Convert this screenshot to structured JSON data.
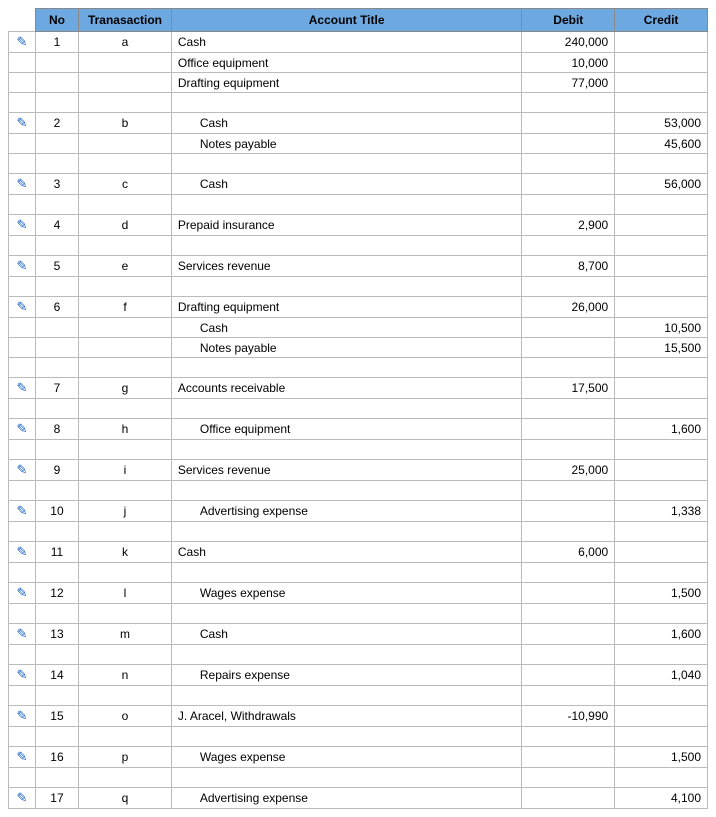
{
  "headers": {
    "no": "No",
    "transaction": "Tranasaction",
    "account_title": "Account Title",
    "debit": "Debit",
    "credit": "Credit"
  },
  "pencil_glyph": "✎",
  "rows": [
    {
      "edit": true,
      "no": "1",
      "trans": "a",
      "title": "Cash",
      "indent": 0,
      "debit": "240,000",
      "credit": ""
    },
    {
      "edit": false,
      "no": "",
      "trans": "",
      "title": "Office equipment",
      "indent": 0,
      "debit": "10,000",
      "credit": ""
    },
    {
      "edit": false,
      "no": "",
      "trans": "",
      "title": "Drafting equipment",
      "indent": 0,
      "debit": "77,000",
      "credit": ""
    },
    {
      "edit": false,
      "no": "",
      "trans": "",
      "title": "",
      "indent": 0,
      "debit": "",
      "credit": ""
    },
    {
      "edit": true,
      "no": "2",
      "trans": "b",
      "title": "Cash",
      "indent": 1,
      "debit": "",
      "credit": "53,000"
    },
    {
      "edit": false,
      "no": "",
      "trans": "",
      "title": "Notes payable",
      "indent": 1,
      "debit": "",
      "credit": "45,600"
    },
    {
      "edit": false,
      "no": "",
      "trans": "",
      "title": "",
      "indent": 0,
      "debit": "",
      "credit": ""
    },
    {
      "edit": true,
      "no": "3",
      "trans": "c",
      "title": "Cash",
      "indent": 1,
      "debit": "",
      "credit": "56,000"
    },
    {
      "edit": false,
      "no": "",
      "trans": "",
      "title": "",
      "indent": 0,
      "debit": "",
      "credit": ""
    },
    {
      "edit": true,
      "no": "4",
      "trans": "d",
      "title": "Prepaid insurance",
      "indent": 0,
      "debit": "2,900",
      "credit": ""
    },
    {
      "edit": false,
      "no": "",
      "trans": "",
      "title": "",
      "indent": 0,
      "debit": "",
      "credit": ""
    },
    {
      "edit": true,
      "no": "5",
      "trans": "e",
      "title": "Services revenue",
      "indent": 0,
      "debit": "8,700",
      "credit": ""
    },
    {
      "edit": false,
      "no": "",
      "trans": "",
      "title": "",
      "indent": 0,
      "debit": "",
      "credit": ""
    },
    {
      "edit": true,
      "no": "6",
      "trans": "f",
      "title": "Drafting equipment",
      "indent": 0,
      "debit": "26,000",
      "credit": ""
    },
    {
      "edit": false,
      "no": "",
      "trans": "",
      "title": "Cash",
      "indent": 1,
      "debit": "",
      "credit": "10,500"
    },
    {
      "edit": false,
      "no": "",
      "trans": "",
      "title": "Notes payable",
      "indent": 1,
      "debit": "",
      "credit": "15,500"
    },
    {
      "edit": false,
      "no": "",
      "trans": "",
      "title": "",
      "indent": 0,
      "debit": "",
      "credit": ""
    },
    {
      "edit": true,
      "no": "7",
      "trans": "g",
      "title": "Accounts receivable",
      "indent": 0,
      "debit": "17,500",
      "credit": ""
    },
    {
      "edit": false,
      "no": "",
      "trans": "",
      "title": "",
      "indent": 0,
      "debit": "",
      "credit": ""
    },
    {
      "edit": true,
      "no": "8",
      "trans": "h",
      "title": "Office equipment",
      "indent": 1,
      "debit": "",
      "credit": "1,600"
    },
    {
      "edit": false,
      "no": "",
      "trans": "",
      "title": "",
      "indent": 0,
      "debit": "",
      "credit": ""
    },
    {
      "edit": true,
      "no": "9",
      "trans": "i",
      "title": "Services revenue",
      "indent": 0,
      "debit": "25,000",
      "credit": ""
    },
    {
      "edit": false,
      "no": "",
      "trans": "",
      "title": "",
      "indent": 0,
      "debit": "",
      "credit": ""
    },
    {
      "edit": true,
      "no": "10",
      "trans": "j",
      "title": "Advertising expense",
      "indent": 1,
      "debit": "",
      "credit": "1,338"
    },
    {
      "edit": false,
      "no": "",
      "trans": "",
      "title": "",
      "indent": 0,
      "debit": "",
      "credit": ""
    },
    {
      "edit": true,
      "no": "11",
      "trans": "k",
      "title": "Cash",
      "indent": 0,
      "debit": "6,000",
      "credit": ""
    },
    {
      "edit": false,
      "no": "",
      "trans": "",
      "title": "",
      "indent": 0,
      "debit": "",
      "credit": ""
    },
    {
      "edit": true,
      "no": "12",
      "trans": "l",
      "title": "Wages expense",
      "indent": 1,
      "debit": "",
      "credit": "1,500"
    },
    {
      "edit": false,
      "no": "",
      "trans": "",
      "title": "",
      "indent": 0,
      "debit": "",
      "credit": ""
    },
    {
      "edit": true,
      "no": "13",
      "trans": "m",
      "title": "Cash",
      "indent": 1,
      "debit": "",
      "credit": "1,600"
    },
    {
      "edit": false,
      "no": "",
      "trans": "",
      "title": "",
      "indent": 0,
      "debit": "",
      "credit": ""
    },
    {
      "edit": true,
      "no": "14",
      "trans": "n",
      "title": "Repairs expense",
      "indent": 1,
      "debit": "",
      "credit": "1,040"
    },
    {
      "edit": false,
      "no": "",
      "trans": "",
      "title": "",
      "indent": 0,
      "debit": "",
      "credit": ""
    },
    {
      "edit": true,
      "no": "15",
      "trans": "o",
      "title": "J. Aracel, Withdrawals",
      "indent": 0,
      "debit": "-10,990",
      "credit": ""
    },
    {
      "edit": false,
      "no": "",
      "trans": "",
      "title": "",
      "indent": 0,
      "debit": "",
      "credit": ""
    },
    {
      "edit": true,
      "no": "16",
      "trans": "p",
      "title": "Wages expense",
      "indent": 1,
      "debit": "",
      "credit": "1,500"
    },
    {
      "edit": false,
      "no": "",
      "trans": "",
      "title": "",
      "indent": 0,
      "debit": "",
      "credit": ""
    },
    {
      "edit": true,
      "no": "17",
      "trans": "q",
      "title": "Advertising expense",
      "indent": 1,
      "debit": "",
      "credit": "4,100"
    }
  ]
}
